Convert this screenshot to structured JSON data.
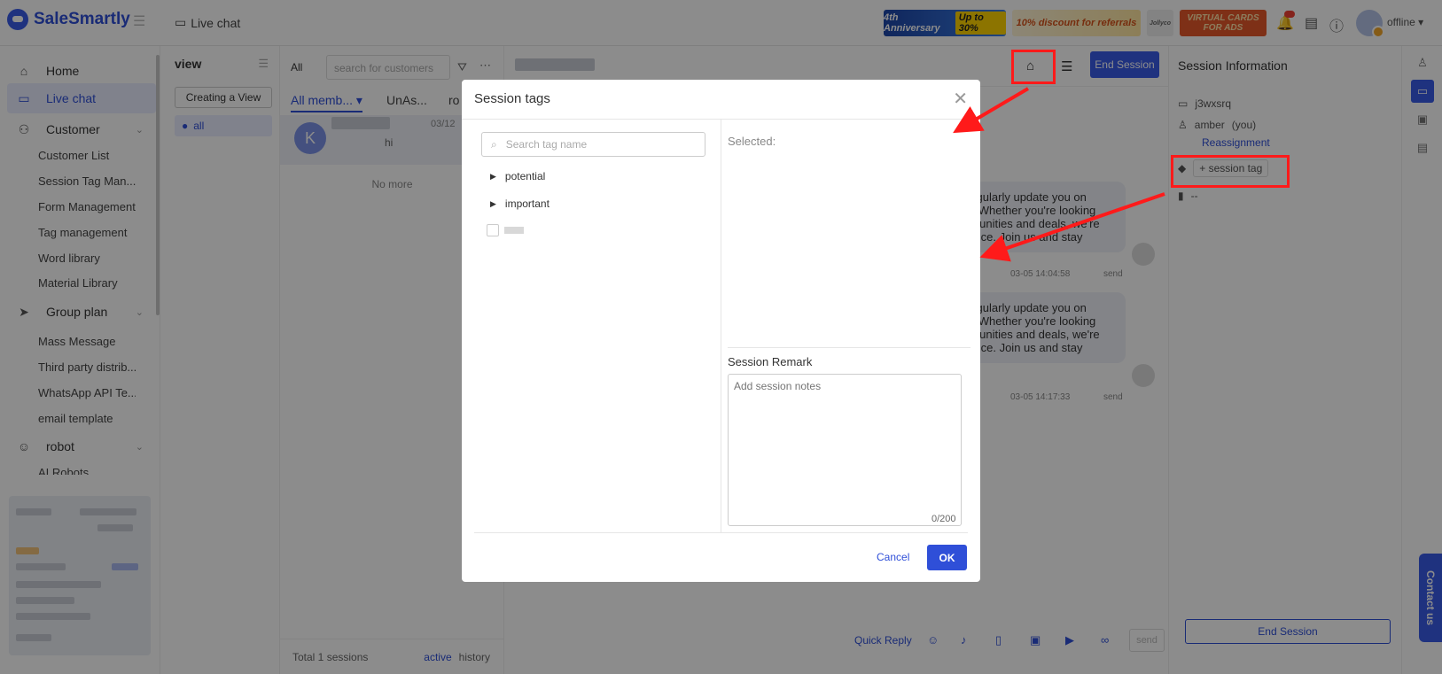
{
  "app": {
    "name": "SaleSmartly",
    "crumb": "Live chat",
    "status": "offline"
  },
  "banners": {
    "b1_text": "4th Anniversary",
    "b1_up": "Up to 30%",
    "b2_text": "10% discount for referrals",
    "b3_text": "Jollyco",
    "b4_text": "VIRTUAL CARDS FOR ADS"
  },
  "sidebar": {
    "home": "Home",
    "live_chat": "Live chat",
    "customer": "Customer",
    "customer_list": "Customer List",
    "session_tag": "Session Tag Man...",
    "form_mgmt": "Form Management",
    "tag_mgmt": "Tag management",
    "word_lib": "Word library",
    "material_lib": "Material Library",
    "group_plan": "Group plan",
    "mass_msg": "Mass Message",
    "third_party": "Third party distrib...",
    "whatsapp": "WhatsApp API Te...",
    "email_tpl": "email template",
    "robot": "robot",
    "ai_robots": "AI Robots"
  },
  "view": {
    "title": "view",
    "create": "Creating a View",
    "all": "all"
  },
  "list": {
    "all": "All",
    "search_ph": "search for customers",
    "tab1": "All memb...",
    "tab2": "UnAs...",
    "tab3": "ro",
    "avatar": "K",
    "msg": "hi",
    "date": "03/12",
    "no_more": "No more",
    "total": "Total 1 sessions",
    "active": "active",
    "history": "history"
  },
  "chat": {
    "end_session": "End Session",
    "m1_lines": [
      "regularly update you on",
      "s. Whether you're looking",
      "ortunities and deals, we're",
      "dvice. Join us and stay"
    ],
    "m1_time": "03-05 14:04:58",
    "m2_lines": [
      "regularly update you on",
      "s. Whether you're looking",
      "ortunities and deals, we're",
      "dvice. Join us and stay"
    ],
    "m2_time": "03-05 14:17:33",
    "send_status": "send",
    "quick_reply": "Quick Reply",
    "send_btn": "send"
  },
  "info": {
    "title": "Session Information",
    "id": "j3wxsrq",
    "user": "amber",
    "you": "(you)",
    "reassign": "Reassignment",
    "session_tag": "+ session tag",
    "dash": "--",
    "end_session": "End Session"
  },
  "modal": {
    "title": "Session tags",
    "search_ph": "Search tag name",
    "tags": [
      "potential",
      "important"
    ],
    "selected": "Selected:",
    "remark_label": "Session Remark",
    "remark_ph": "Add session notes",
    "counter": "0/200",
    "cancel": "Cancel",
    "ok": "OK"
  },
  "contact": "Contact us",
  "colors": {
    "accent": "#2f4fd8",
    "highlight": "#ff1a1a"
  }
}
